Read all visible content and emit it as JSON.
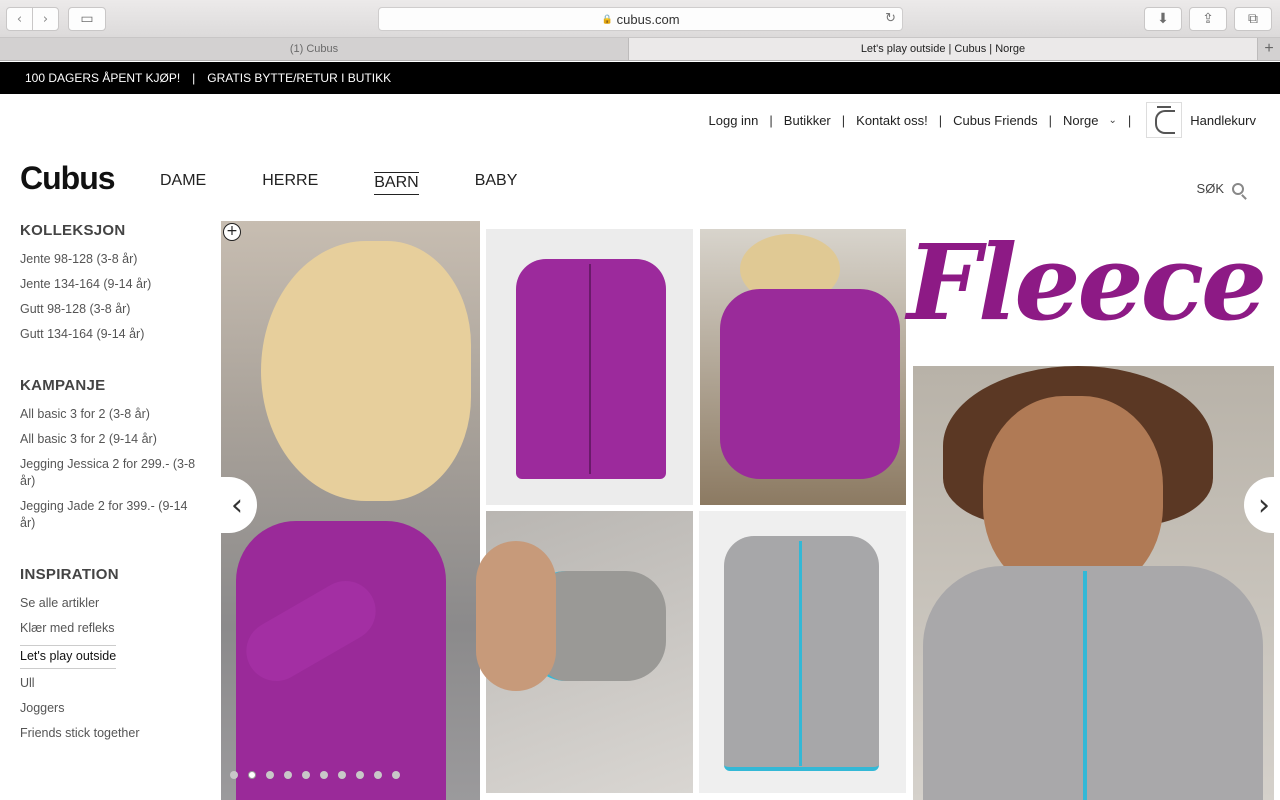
{
  "browser": {
    "url": "cubus.com",
    "tabs": [
      "(1) Cubus",
      "Let's play outside | Cubus | Norge"
    ]
  },
  "promo": {
    "item1": "100 DAGERS ÅPENT KJØP!",
    "item2": "GRATIS BYTTE/RETUR I BUTIKK"
  },
  "util_nav": {
    "login": "Logg inn",
    "stores": "Butikker",
    "contact": "Kontakt oss!",
    "friends": "Cubus Friends",
    "country": "Norge",
    "cart": "Handlekurv"
  },
  "logo": "Cubus",
  "main_nav": [
    "DAME",
    "HERRE",
    "BARN",
    "BABY"
  ],
  "search_label": "SØK",
  "sidebar": {
    "kolleksjon": {
      "title": "KOLLEKSJON",
      "items": [
        "Jente 98-128 (3-8 år)",
        "Jente 134-164 (9-14 år)",
        "Gutt 98-128 (3-8 år)",
        "Gutt 134-164 (9-14 år)"
      ]
    },
    "kampanje": {
      "title": "KAMPANJE",
      "items": [
        "All basic 3 for 2 (3-8 år)",
        "All basic 3 for 2 (9-14 år)",
        "Jegging Jessica 2 for 299.- (3-8 år)",
        "Jegging Jade 2 for 399.- (9-14 år)"
      ]
    },
    "inspiration": {
      "title": "INSPIRATION",
      "items": [
        "Se alle artikler",
        "Klær med refleks",
        "Let's play outside",
        "Ull",
        "Joggers",
        "Friends stick together"
      ]
    }
  },
  "hero": {
    "headline": "Fleece",
    "slide_count": 10,
    "active_slide": 2
  }
}
